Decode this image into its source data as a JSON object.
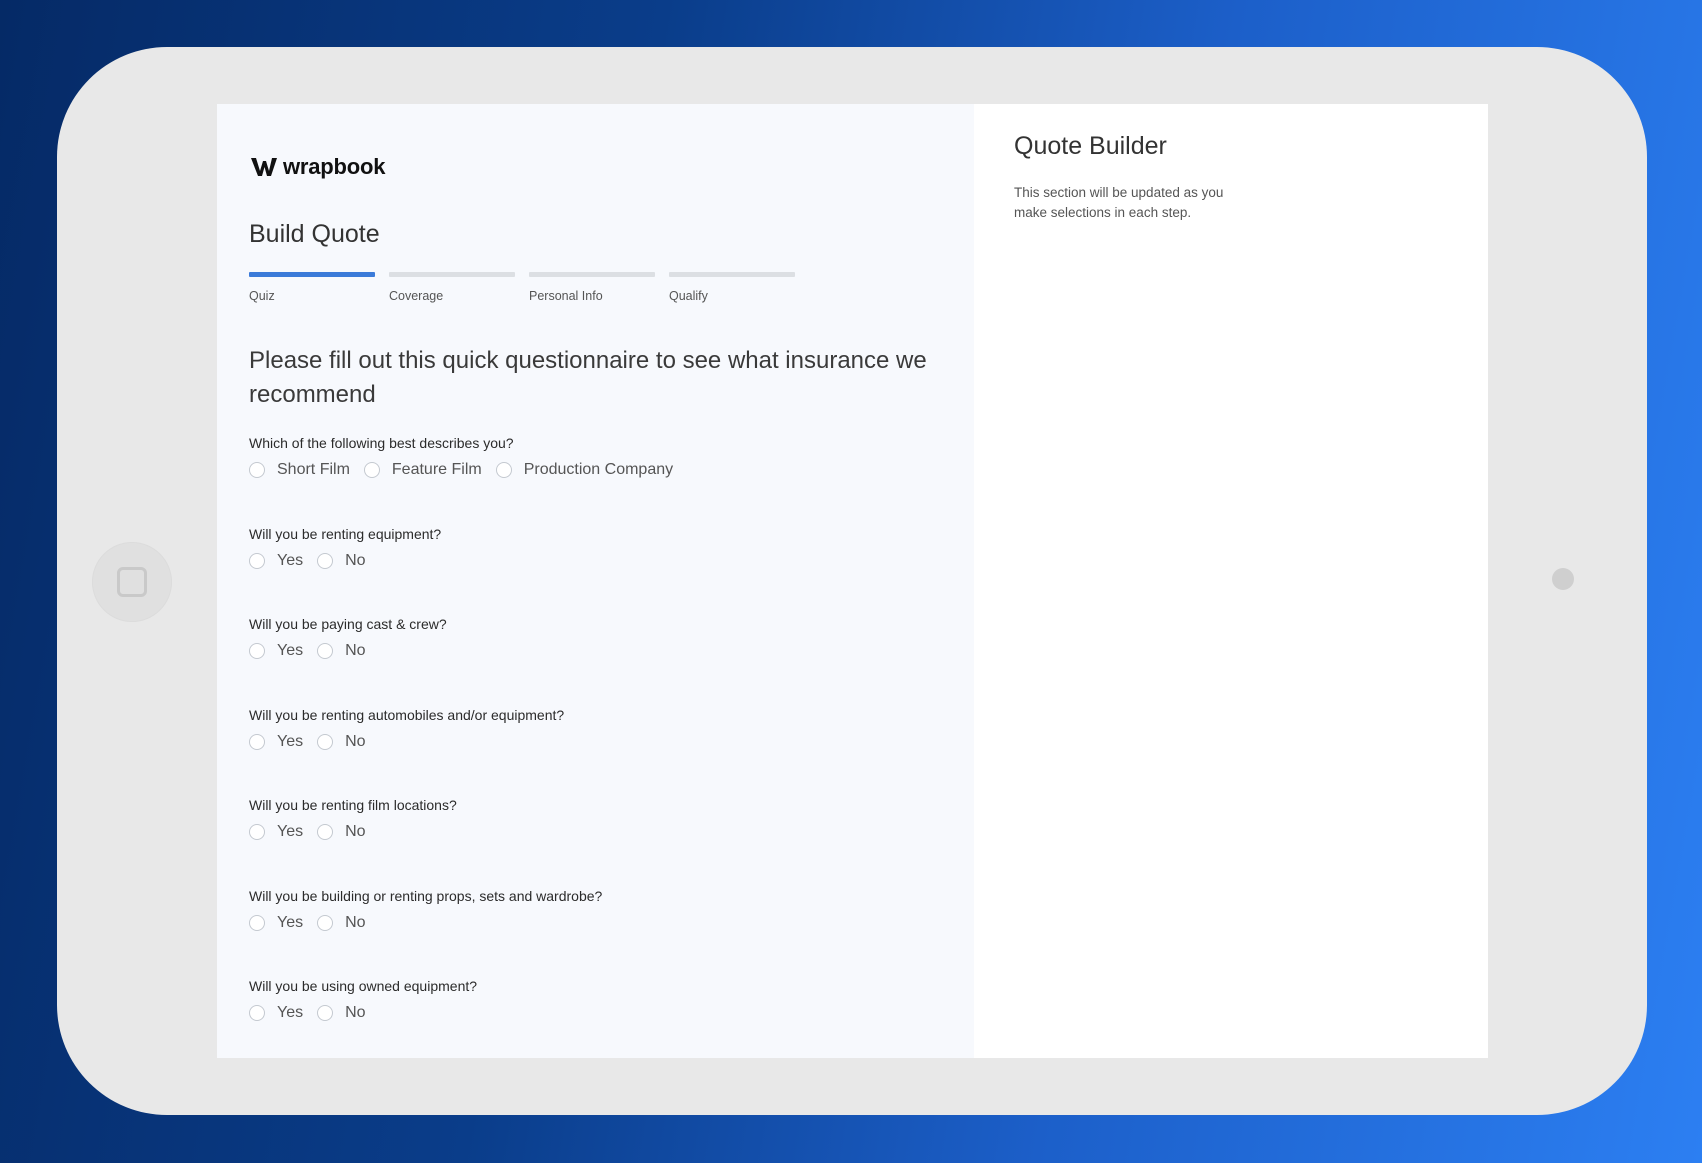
{
  "brand": {
    "name": "wrapbook"
  },
  "page_title": "Build Quote",
  "steps": [
    {
      "label": "Quiz",
      "active": true
    },
    {
      "label": "Coverage",
      "active": false
    },
    {
      "label": "Personal Info",
      "active": false
    },
    {
      "label": "Qualify",
      "active": false
    }
  ],
  "intro": "Please fill out this quick questionnaire to see what insurance we recommend",
  "questions": [
    {
      "label": "Which of the following best describes you?",
      "options": [
        "Short Film",
        "Feature Film",
        "Production Company"
      ]
    },
    {
      "label": "Will you be renting equipment?",
      "options": [
        "Yes",
        "No"
      ]
    },
    {
      "label": "Will you be paying cast & crew?",
      "options": [
        "Yes",
        "No"
      ]
    },
    {
      "label": "Will you be renting automobiles and/or equipment?",
      "options": [
        "Yes",
        "No"
      ]
    },
    {
      "label": "Will you be renting film locations?",
      "options": [
        "Yes",
        "No"
      ]
    },
    {
      "label": "Will you be building or renting props, sets and wardrobe?",
      "options": [
        "Yes",
        "No"
      ]
    },
    {
      "label": "Will you be using owned equipment?",
      "options": [
        "Yes",
        "No"
      ]
    }
  ],
  "quote_builder": {
    "title": "Quote Builder",
    "description": "This section will be updated as you make selections in each step."
  },
  "colors": {
    "accent": "#3b7bd9",
    "inactive_step": "#dcdfe3",
    "tablet_frame": "#e8e8e8"
  }
}
